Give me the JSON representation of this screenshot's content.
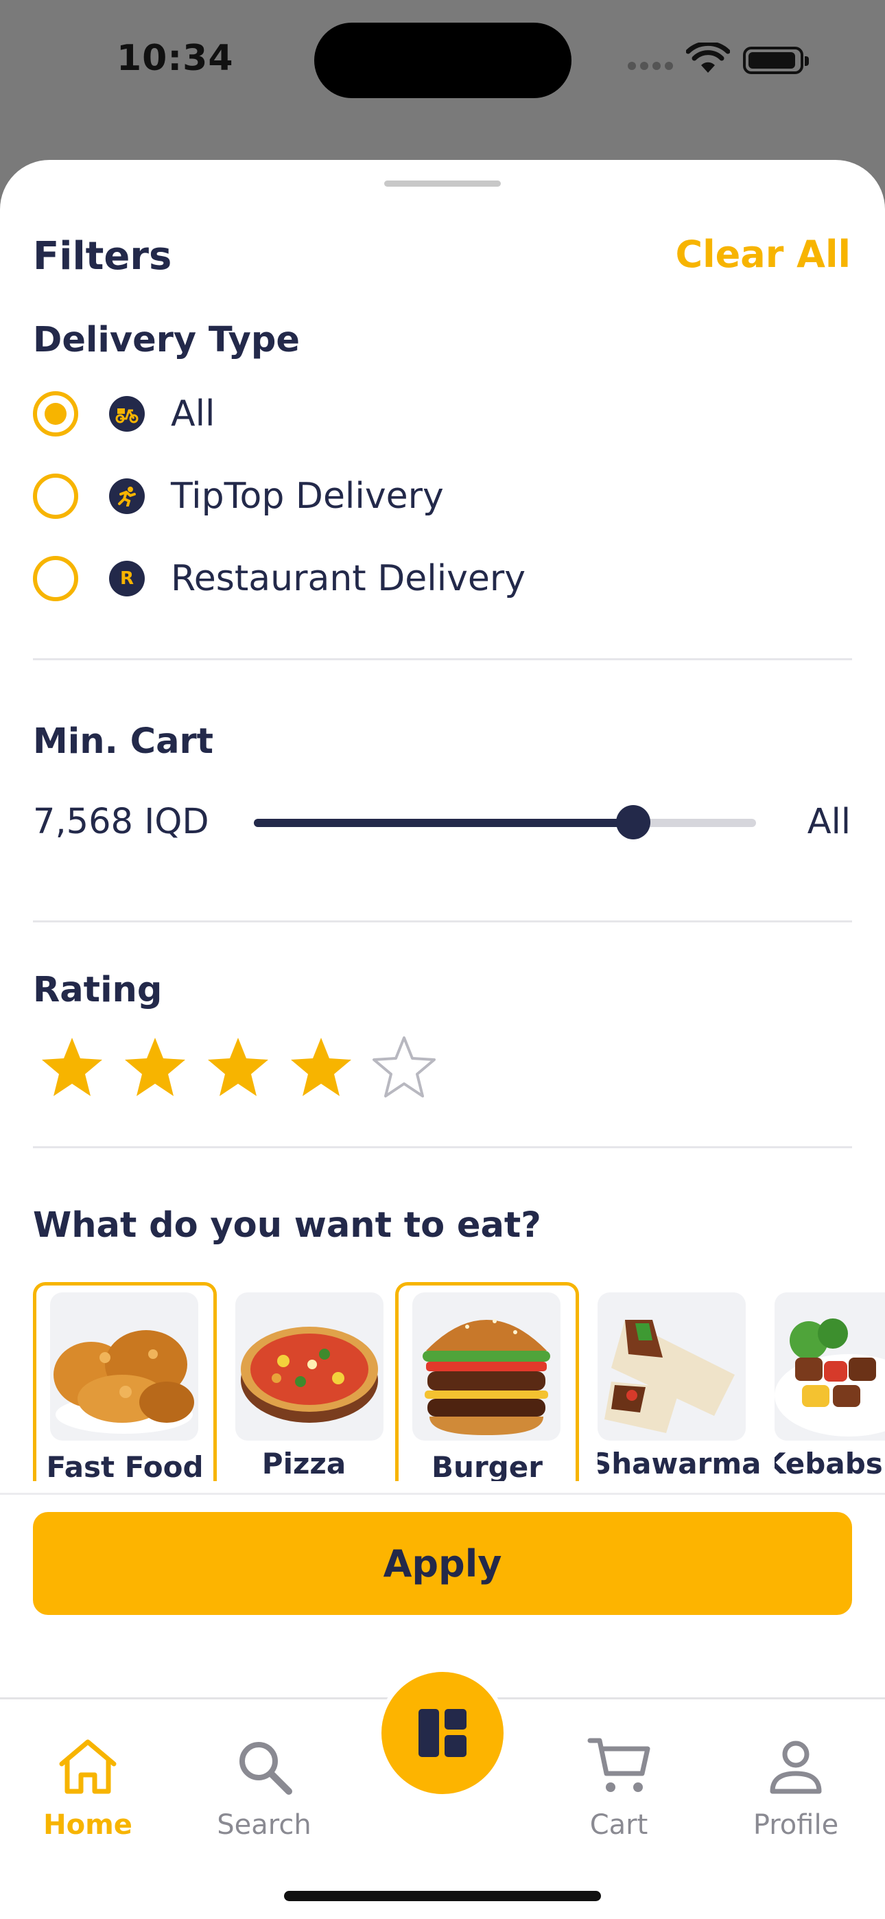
{
  "status": {
    "time": "10:34"
  },
  "filters": {
    "title": "Filters",
    "clear_all": "Clear All",
    "delivery_type": {
      "title": "Delivery Type",
      "options": [
        {
          "label": "All",
          "selected": true,
          "icon": "scooter-icon"
        },
        {
          "label": "TipTop Delivery",
          "selected": false,
          "icon": "runner-icon"
        },
        {
          "label": "Restaurant Delivery",
          "selected": false,
          "icon": "restaurant-r-icon",
          "icon_text": "R"
        }
      ]
    },
    "min_cart": {
      "title": "Min. Cart",
      "value": "7,568 IQD",
      "max_label": "All",
      "slider_fraction": 0.755
    },
    "rating": {
      "title": "Rating",
      "value": 4,
      "max": 5
    },
    "food": {
      "title": "What do you want to eat?",
      "items": [
        {
          "label": "Fast Food",
          "selected": true
        },
        {
          "label": "Pizza",
          "selected": false
        },
        {
          "label": "Burger",
          "selected": true
        },
        {
          "label": "Shawarma",
          "selected": false
        },
        {
          "label": "Kebabs",
          "selected": false
        }
      ]
    },
    "apply": "Apply"
  },
  "tabs": [
    {
      "label": "Home",
      "icon": "home-icon",
      "active": true
    },
    {
      "label": "Search",
      "icon": "search-icon",
      "active": false
    },
    {
      "label": "Cart",
      "icon": "cart-icon",
      "active": false
    },
    {
      "label": "Profile",
      "icon": "profile-icon",
      "active": false
    }
  ],
  "center_action": {
    "icon": "dashboard-icon"
  },
  "colors": {
    "accent": "#FDB400",
    "navy": "#23294A",
    "muted": "#8A8A92"
  }
}
